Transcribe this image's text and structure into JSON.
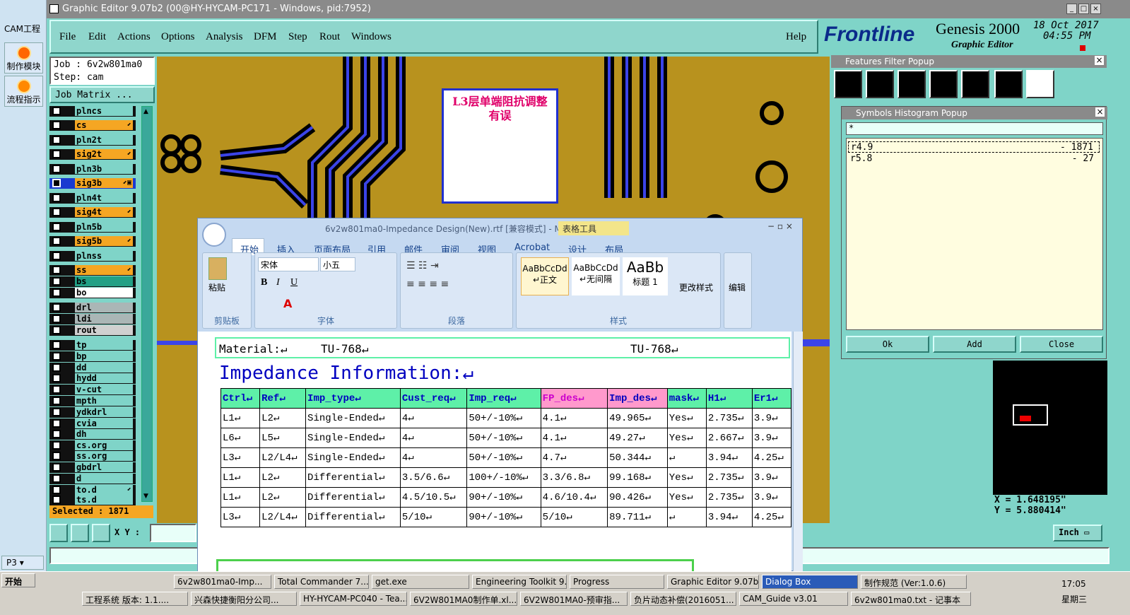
{
  "cam": {
    "title": "CAM工程",
    "tool1": "制作模块",
    "tool2": "流程指示",
    "page": "P3"
  },
  "window": {
    "title": "Graphic Editor 9.07b2 (00@HY-HYCAM-PC171 - Windows, pid:7952)"
  },
  "menu": [
    "File",
    "Edit",
    "Actions",
    "Options",
    "Analysis",
    "DFM",
    "Step",
    "Rout",
    "Windows"
  ],
  "help": "Help",
  "brand": {
    "logo": "Frontline",
    "product": "Genesis 2000",
    "sub": "Graphic Editor",
    "date": "18 Oct 2017",
    "time": "04:55 PM"
  },
  "job": {
    "job": "Job : 6v2w801ma0",
    "step": "Step: cam",
    "matrix": "Job Matrix ..."
  },
  "layers": [
    {
      "name": "plncs",
      "color": "#7fd4c8"
    },
    {
      "name": "cs",
      "color": "#f5a623",
      "flag": "⬋"
    },
    {
      "name": "pln2t",
      "color": "#7fd4c8"
    },
    {
      "name": "sig2t",
      "color": "#f5a623",
      "flag": "⬋"
    },
    {
      "name": "pln3b",
      "color": "#7fd4c8"
    },
    {
      "name": "sig3b",
      "color": "#f5a623",
      "flag": "⬋▣",
      "active": true
    },
    {
      "name": "pln4t",
      "color": "#7fd4c8"
    },
    {
      "name": "sig4t",
      "color": "#f5a623",
      "flag": "⬋"
    },
    {
      "name": "pln5b",
      "color": "#7fd4c8"
    },
    {
      "name": "sig5b",
      "color": "#f5a623",
      "flag": "⬋"
    },
    {
      "name": "plnss",
      "color": "#7fd4c8"
    },
    {
      "name": "ss",
      "color": "#f5a623",
      "flag": "⬋"
    },
    {
      "name": "bs",
      "color": "#22a085"
    },
    {
      "name": "bo",
      "color": "#ffffff"
    },
    {
      "name": "drl",
      "color": "#aab6b6"
    },
    {
      "name": "ldi",
      "color": "#aab6b6"
    },
    {
      "name": "rout",
      "color": "#d0d0d0"
    },
    {
      "name": "tp",
      "color": "#7fd4c8"
    },
    {
      "name": "bp",
      "color": "#7fd4c8"
    },
    {
      "name": "dd",
      "color": "#7fd4c8"
    },
    {
      "name": "hydd",
      "color": "#7fd4c8"
    },
    {
      "name": "v-cut",
      "color": "#7fd4c8"
    },
    {
      "name": "mpth",
      "color": "#7fd4c8"
    },
    {
      "name": "ydkdrl",
      "color": "#7fd4c8"
    },
    {
      "name": "cvia",
      "color": "#7fd4c8"
    },
    {
      "name": "dh",
      "color": "#7fd4c8"
    },
    {
      "name": "cs.org",
      "color": "#7fd4c8"
    },
    {
      "name": "ss.org",
      "color": "#7fd4c8"
    },
    {
      "name": "gbdrl",
      "color": "#7fd4c8"
    },
    {
      "name": "d",
      "color": "#7fd4c8"
    },
    {
      "name": "to.d",
      "color": "#7fd4c8",
      "flag": "⬋"
    },
    {
      "name": "ts.d",
      "color": "#7fd4c8"
    }
  ],
  "selected": "Selected : 1871",
  "xy": {
    "label": "X Y :"
  },
  "note": "L3层单端阻抗调整有误",
  "word": {
    "title": "6v2w801ma0-Impedance Design(New).rtf [兼容模式] - M",
    "tabletools": "表格工具",
    "tabs": [
      "开始",
      "插入",
      "页面布局",
      "引用",
      "邮件",
      "审阅",
      "视图",
      "Acrobat",
      "设计",
      "布局"
    ],
    "groups": {
      "clip": "剪贴板",
      "font": "字体",
      "para": "段落",
      "styles": "样式",
      "edit": "编辑"
    },
    "paste": "粘贴",
    "fontname": "宋体",
    "fontsize": "小五",
    "styles": [
      {
        "sample": "AaBbCcDd",
        "name": "↵正文"
      },
      {
        "sample": "AaBbCcDd",
        "name": "↵无间隔"
      },
      {
        "sample": "AaBb",
        "name": "标题 1"
      }
    ],
    "changestyle": "更改样式",
    "editlabel": "编辑",
    "material": {
      "label": "Material:↵",
      "v1": "TU-768↵",
      "v2": "TU-768↵"
    },
    "heading": "Impedance Information:↵",
    "cols": [
      "Ctrl↵",
      "Ref↵",
      "Imp_type↵",
      "Cust_req↵",
      "Imp_req↵",
      "FP_des↵",
      "Imp_des↵",
      "mask↵",
      "H1↵",
      "Er1↵"
    ],
    "rows": [
      [
        "L1↵",
        "L2↵",
        "Single-Ended↵",
        "4↵",
        "50+/-10%↵",
        "4.1↵",
        "49.965↵",
        "Yes↵",
        "2.735↵",
        "3.9↵"
      ],
      [
        "L6↵",
        "L5↵",
        "Single-Ended↵",
        "4↵",
        "50+/-10%↵",
        "4.1↵",
        "49.27↵",
        "Yes↵",
        "2.667↵",
        "3.9↵"
      ],
      [
        "L3↵",
        "L2/L4↵",
        "Single-Ended↵",
        "4↵",
        "50+/-10%↵",
        "4.7↵",
        "50.344↵",
        "↵",
        "3.94↵",
        "4.25↵"
      ],
      [
        "L1↵",
        "L2↵",
        "Differential↵",
        "3.5/6.6↵",
        "100+/-10%↵",
        "3.3/6.8↵",
        "99.168↵",
        "Yes↵",
        "2.735↵",
        "3.9↵"
      ],
      [
        "L1↵",
        "L2↵",
        "Differential↵",
        "4.5/10.5↵",
        "90+/-10%↵",
        "4.6/10.4↵",
        "90.426↵",
        "Yes↵",
        "2.735↵",
        "3.9↵"
      ],
      [
        "L3↵",
        "L2/L4↵",
        "Differential↵",
        "5/10↵",
        "90+/-10%↵",
        "5/10↵",
        "89.711↵",
        "↵",
        "3.94↵",
        "4.25↵"
      ]
    ]
  },
  "ffp": {
    "title": "Features Filter Popup"
  },
  "shp": {
    "title": "Symbols Histogram Popup",
    "filter": "*",
    "rows": [
      {
        "sym": "r4.9",
        "count": "- 1871"
      },
      {
        "sym": "r5.8",
        "count": "- 27"
      }
    ],
    "ok": "Ok",
    "add": "Add",
    "close": "Close"
  },
  "coords": {
    "x": "X = 1.648195\"",
    "y": "Y = 5.880414\""
  },
  "units": "Inch",
  "taskbar": {
    "start": "开始",
    "row1": [
      "6v2w801ma0-Imp...",
      "Total Commander 7....",
      "get.exe",
      "Engineering Toolkit 9...",
      "Progress",
      "Graphic Editor 9.07b...",
      "Dialog Box",
      "制作规范 (Ver:1.0.6)"
    ],
    "row2": [
      "工程系统 版本: 1.1....",
      "兴森快捷衡阳分公司...",
      "HY-HYCAM-PC040 - Tea...",
      "6V2W801MA0制作单.xl...",
      "6V2W801MA0-预审指...",
      "负片动态补偿(2016051...",
      "CAM_Guide v3.01",
      "6v2w801ma0.txt - 记事本"
    ],
    "clock": "17:05",
    "day": "星期三"
  }
}
